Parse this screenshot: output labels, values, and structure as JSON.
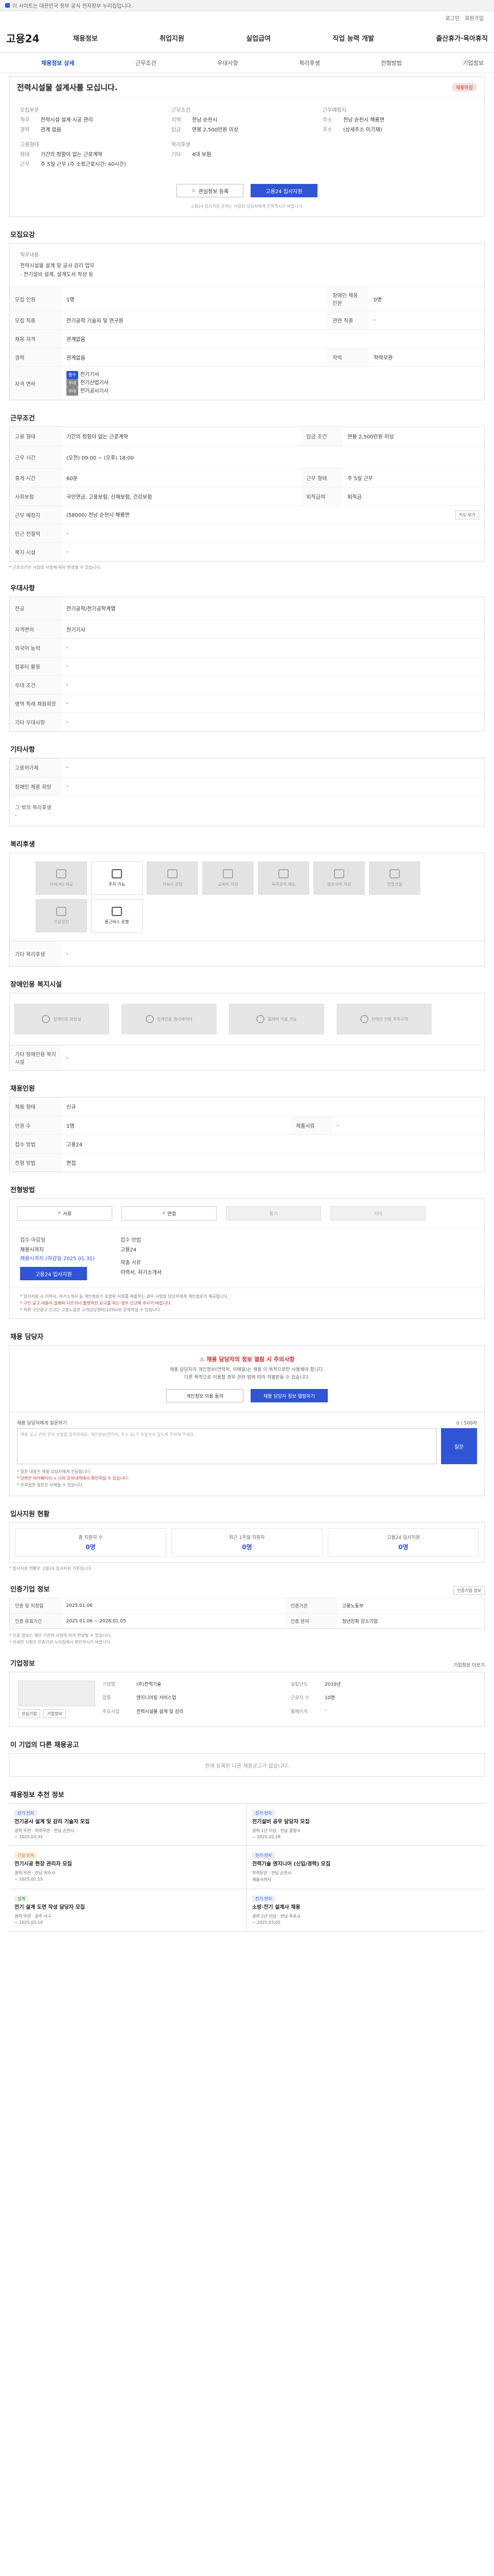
{
  "topbar": {
    "text": "이 사이트는 대한민국 정부 공식 전자정부 누리집입니다."
  },
  "util": {
    "links": [
      "로그인",
      "회원가입"
    ]
  },
  "header": {
    "logo": "고용24",
    "nav": [
      "채용정보",
      "취업지원",
      "실업급여",
      "직업 능력 개발",
      "출산휴가·육아휴직"
    ]
  },
  "subnav": [
    "채용정보 상세",
    "근무조건",
    "우대사항",
    "복리후생",
    "전형방법",
    "기업정보"
  ],
  "summary": {
    "title": "전력시설물 설계사를 모십니다.",
    "status": "채용마감",
    "company_title": "모집부문",
    "company_rows": [
      {
        "k": "직무",
        "v": "전력시설 설계·시공 관리"
      },
      {
        "k": "경력",
        "v": "관계 없음"
      }
    ],
    "cond_title": "근무조건",
    "cond_rows": [
      {
        "k": "지역",
        "v": "전남 순천시"
      },
      {
        "k": "임금",
        "v": "연봉 2,500만원 이상"
      }
    ],
    "place_title": "근무예정지",
    "place_rows": [
      {
        "k": "주소",
        "v": "전남 순천시 해룡면"
      },
      {
        "k": "주소",
        "v": "(상세주소 미기재)"
      }
    ],
    "edu_title": "고용형태",
    "edu_rows": [
      {
        "k": "형태",
        "v": "기간의 정함이 없는 근로계약"
      },
      {
        "k": "근무",
        "v": "주 5일 근무 (주 소정근로시간: 40시간)"
      }
    ],
    "welfare_title": "복리후생",
    "welfare_rows": [
      {
        "k": "기타",
        "v": "4대 보험"
      }
    ],
    "btn_save": "관심정보 등록",
    "btn_apply": "고용24 입사지원",
    "note": "고용24 입사지원 문의는 사업장 담당자에게 문의하시기 바랍니다."
  },
  "sections": {
    "recruit": "모집요강",
    "work": "근무조건",
    "pref": "우대사항",
    "other": "기타사항",
    "welfare": "복리후생",
    "disability": "장애인용 복지시설",
    "personnel": "채용인원",
    "process": "전형방법",
    "contact": "채용 담당자",
    "stats": "입사지원 현황",
    "notice": "인증기업 정보",
    "company": "기업정보",
    "same": "이 기업의 다른 채용공고",
    "rec": "채용정보 추천 정보"
  },
  "recruit": {
    "desc_title": "직무내용",
    "desc": [
      "전력시설물 설계 및 공사 감리 업무",
      "- 전기설비 설계, 설계도서 작성 등"
    ],
    "rows": [
      {
        "k": "모집 인원",
        "v": "1명",
        "k2": "장애인 채용 인원",
        "v2": "0명"
      },
      {
        "k": "모집 직종",
        "v": "전기공학 기술자 및 연구원",
        "k2": "관련 직종",
        "v2": "-"
      },
      {
        "k": "채용 자격",
        "v": "관계없음",
        "k2": "",
        "v2": ""
      },
      {
        "k": "경력",
        "v": "관계없음",
        "k2": "학력",
        "v2": "학력무관"
      }
    ],
    "license_k": "자격 면허",
    "licenses": [
      "전기기사",
      "전기산업기사",
      "전기공사기사"
    ]
  },
  "work": {
    "rows": [
      {
        "k": "고용 형태",
        "v": "기간의 정함이 없는 근로계약",
        "k2": "임금 조건",
        "v2": "연봉 2,500만원 이상"
      },
      {
        "k": "근무 시간",
        "v": "(오전) 09:00 ~ (오후) 18:00",
        "k2": "",
        "v2": ""
      },
      {
        "k": "휴게 시간",
        "v": "60분",
        "k2": "근무 형태",
        "v2": "주 5일 근무"
      },
      {
        "k": "사회보험",
        "v": "국민연금, 고용보험, 산재보험, 건강보험",
        "k2": "퇴직급여",
        "v2": "퇴직금"
      },
      {
        "k": "근무 예정지",
        "v": "(58000) 전남 순천시 해룡면",
        "k2": "",
        "v2": ""
      },
      {
        "k": "인근 전철역",
        "v": "-",
        "k2": "",
        "v2": ""
      },
      {
        "k": "복지 시설",
        "v": "-",
        "k2": "",
        "v2": ""
      }
    ],
    "map_btn": "지도 보기",
    "note": "* 근로조건은 사업장 사정에 따라 변경될 수 있습니다."
  },
  "pref": {
    "rows": [
      {
        "k": "전공",
        "v": "전기공학/전기공학계열"
      },
      {
        "k": "자격면허",
        "v": "전기기사"
      },
      {
        "k": "외국어 능력",
        "v": "-"
      },
      {
        "k": "컴퓨터 활용",
        "v": "-"
      },
      {
        "k": "우대 조건",
        "v": "-"
      },
      {
        "k": "병역 특례 채용희망",
        "v": "-"
      },
      {
        "k": "기타 우대사항",
        "v": "-"
      }
    ]
  },
  "other": {
    "rows": [
      {
        "k": "고용허가제",
        "v": "-"
      },
      {
        "k": "장애인 채용 희망",
        "v": "-"
      }
    ],
    "extra_k": "그 밖의 복리후생",
    "extra_v": "-"
  },
  "welfare": {
    "items": [
      {
        "label": "식사(비) 제공",
        "on": false
      },
      {
        "label": "주차 가능",
        "on": true
      },
      {
        "label": "기숙사 운영",
        "on": false
      },
      {
        "label": "교육비 지원",
        "on": false
      },
      {
        "label": "육아휴직 제도",
        "on": false
      },
      {
        "label": "경조사비 지원",
        "on": false
      },
      {
        "label": "명절선물",
        "on": false
      },
      {
        "label": "건강검진",
        "on": false
      },
      {
        "label": "통근버스 운행",
        "on": true
      }
    ],
    "etc_k": "기타 복리후생",
    "etc_v": "-"
  },
  "disability": {
    "items": [
      "장애인용 화장실",
      "장애인용 엘리베이터",
      "휠체어 이용 가능",
      "장애인 전용 주차구역"
    ],
    "etc_k": "기타 장애인용 복지시설",
    "etc_v": "-"
  },
  "personnel": {
    "rows": [
      {
        "k": "채용 형태",
        "v": "신규",
        "k2": "",
        "v2": ""
      },
      {
        "k": "인원 수",
        "v": "1명",
        "k2": "제출서류",
        "v2": "-"
      },
      {
        "k": "접수 방법",
        "v": "고용24",
        "k2": "",
        "v2": ""
      },
      {
        "k": "전형 방법",
        "v": "면접",
        "k2": "",
        "v2": ""
      }
    ]
  },
  "process": {
    "steps": [
      {
        "label": "서류",
        "on": true
      },
      {
        "label": "면접",
        "on": true
      },
      {
        "label": "필기",
        "on": false
      },
      {
        "label": "기타",
        "on": false
      }
    ],
    "apply_label": "접수 마감일",
    "apply_val": "채용시까지",
    "apply_link": "채용시까지 (마감일 2025.01.31)",
    "btn": "고용24 입사지원",
    "method_label": "접수 방법",
    "method_val": "고용24",
    "doc_label": "제출 서류",
    "doc_val": "이력서, 자기소개서",
    "notes": [
      "* 입사지원 시 이력서, 자기소개서 등 개인정보가 포함된 서류를 제출하는 경우 사업장 담당자에게 개인정보가 제공됩니다.",
      "* 구인 공고 내용이 실제와 다르거나 불법적인 요구를 하는 경우 신고해 주시기 바랍니다.",
      "* 허위 구인광고 신고는 고용노동부 고객상담센터(1350)로 문의하실 수 있습니다."
    ]
  },
  "contact": {
    "title": "채용 담당자의 정보 열람 시 주의사항",
    "desc1": "채용 담당자의 개인정보(연락처, 이메일)는 채용 이 목적으로만 사용해야 합니다.",
    "desc2": "다른 목적으로 이용할 경우 관련 법에 따라 처벌받을 수 있습니다.",
    "btn1": "개인정보 이용 동의",
    "btn2": "채용 담당자 정보 열람하기",
    "inq_title": "채용 담당자에게 질문하기",
    "inq_count": "0 / 500자",
    "inq_placeholder": "채용 공고 관련 문의 사항을 입력하세요. 개인정보(연락처, 주소 등)가 포함되지 않도록 주의해 주세요.",
    "inq_btn": "질문",
    "inq_notes": [
      "* 질문 내용은 채용 담당자에게 전달됩니다.",
      "* 답변은 마이페이지 > 나의 문의내역에서 확인하실 수 있습니다.",
      "* 부적절한 질문은 삭제될 수 있습니다."
    ]
  },
  "stats": {
    "items": [
      {
        "label": "총 지원자 수",
        "n": "0명"
      },
      {
        "label": "최근 1주일 지원자",
        "n": "0명"
      },
      {
        "label": "고용24 입사지원",
        "n": "0명"
      }
    ],
    "note": "* 입사지원 현황은 고용24 입사지원 기준입니다."
  },
  "notice": {
    "btn": "인증기업 정보",
    "rows": [
      {
        "k": "인증 및 지정일",
        "v": "2025.01.06",
        "k2": "인증기관",
        "v2": "고용노동부"
      },
      {
        "k": "인증 유효기간",
        "v": "2025.01.06 ~ 2028.01.05",
        "k2": "인증 분야",
        "v2": "청년친화 강소기업"
      }
    ],
    "notes": [
      "* 인증 정보는 해당 기관의 사정에 따라 변경될 수 있습니다.",
      "* 자세한 사항은 인증기관 누리집에서 확인하시기 바랍니다."
    ]
  },
  "company": {
    "more": "기업정보 더보기",
    "rows": [
      {
        "k": "기업명",
        "v": "(주)전력기술",
        "k2": "설립년도",
        "v2": "2010년"
      },
      {
        "k": "업종",
        "v": "엔지니어링 서비스업",
        "k2": "근로자 수",
        "v2": "10명"
      },
      {
        "k": "주요사업",
        "v": "전력시설물 설계 및 감리",
        "k2": "홈페이지",
        "v2": "-"
      }
    ],
    "btn1": "관심기업",
    "btn2": "기업정보"
  },
  "same": {
    "empty": "현재 등록된 다른 채용공고가 없습니다."
  },
  "rec": {
    "items": [
      {
        "tag": "전기·전자",
        "title": "전기공사 설계 및 감리 기술자 모집",
        "meta": "경력 무관 · 학력무관 · 전남 순천시",
        "date": "~ 2025.03.31"
      },
      {
        "tag": "전기·전자",
        "title": "전기설비 공무 담당자 모집",
        "meta": "경력 1년 이상 · 전남 광양시",
        "date": "~ 2025.02.28"
      },
      {
        "tag": "건설·토목",
        "title": "전기시공 현장 관리자 모집",
        "meta": "경력 무관 · 전남 여수시",
        "date": "~ 2025.02.15"
      },
      {
        "tag": "전기·전자",
        "title": "전력기술 엔지니어 (신입/경력) 모집",
        "meta": "학력무관 · 전남 순천시",
        "date": "채용시까지"
      },
      {
        "tag": "설계",
        "title": "전기 설계 도면 작성 담당자 모집",
        "meta": "경력 무관 · 광주 서구",
        "date": "~ 2025.03.10"
      },
      {
        "tag": "전기·전자",
        "title": "소방·전기 설계사 채용",
        "meta": "경력 2년 이상 · 전남 목포시",
        "date": "~ 2025.03.05"
      }
    ]
  },
  "colors": {
    "primary": "#2f55d4",
    "danger": "#c83030"
  }
}
